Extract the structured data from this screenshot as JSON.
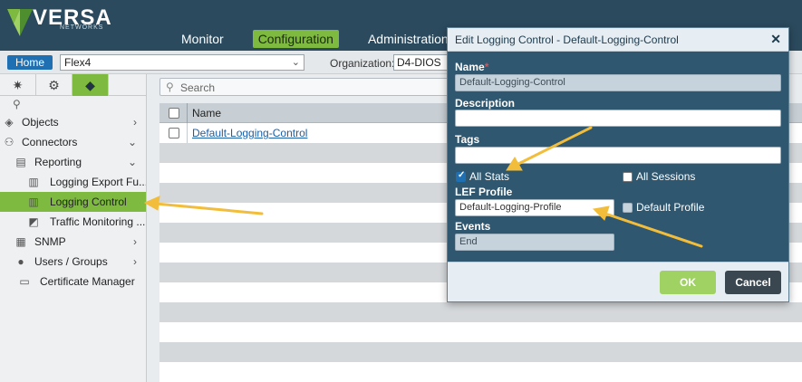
{
  "brand": {
    "name": "VERSA",
    "sub": "NETWORKS"
  },
  "nav": {
    "items": [
      {
        "label": "Monitor",
        "active": false
      },
      {
        "label": "Configuration",
        "active": true
      },
      {
        "label": "Administration",
        "active": false
      }
    ]
  },
  "context": {
    "home_label": "Home",
    "appliance_value": "Flex4",
    "org_label": "Organization:",
    "org_value": "D4-DIOS"
  },
  "sidebar": {
    "tabs": [
      {
        "icon": "network-icon"
      },
      {
        "icon": "gear-icon"
      },
      {
        "icon": "cube-icon"
      }
    ],
    "items": [
      {
        "label": "Objects",
        "icon": "cube-icon",
        "indent": 0,
        "arrow": "right"
      },
      {
        "label": "Connectors",
        "icon": "connectors-icon",
        "indent": 0,
        "arrow": "down"
      },
      {
        "label": "Reporting",
        "icon": "chart-icon",
        "indent": 1,
        "arrow": "down"
      },
      {
        "label": "Logging Export Fu...",
        "icon": "export-icon",
        "indent": 2,
        "arrow": ""
      },
      {
        "label": "Logging Control",
        "icon": "log-control-icon",
        "indent": 2,
        "arrow": "",
        "selected": true
      },
      {
        "label": "Traffic Monitoring ...",
        "icon": "monitor-icon",
        "indent": 2,
        "arrow": ""
      },
      {
        "label": "SNMP",
        "icon": "snmp-icon",
        "indent": 0,
        "arrow": "right"
      },
      {
        "label": "Users / Groups",
        "icon": "user-icon",
        "indent": 0,
        "arrow": "right"
      },
      {
        "label": "Certificate Manager",
        "icon": "certificate-icon",
        "indent": 1,
        "arrow": ""
      }
    ]
  },
  "main": {
    "search_placeholder": "Search",
    "column_name": "Name",
    "rows": [
      {
        "name": "Default-Logging-Control"
      }
    ]
  },
  "modal": {
    "title": "Edit Logging Control - Default-Logging-Control",
    "close": "✕",
    "name_label": "Name",
    "name_value": "Default-Logging-Control",
    "description_label": "Description",
    "description_value": "",
    "tags_label": "Tags",
    "tags_value": "",
    "all_stats_label": "All Stats",
    "all_stats_checked": true,
    "all_sessions_label": "All Sessions",
    "all_sessions_checked": false,
    "lef_profile_label": "LEF Profile",
    "lef_profile_value": "Default-Logging-Profile",
    "default_profile_label": "Default Profile",
    "default_profile_checked": false,
    "events_label": "Events",
    "events_value": "End",
    "ok_label": "OK",
    "cancel_label": "Cancel"
  },
  "colors": {
    "topbar": "#2b4a5d",
    "accent_green": "#7dba3f",
    "modal_body": "#2f5770",
    "annotation_arrow": "#f2bd3a"
  }
}
